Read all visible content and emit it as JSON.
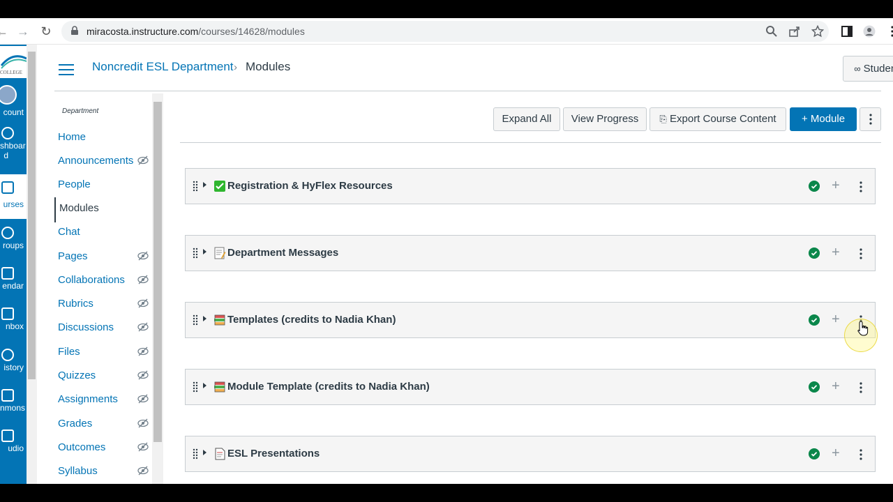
{
  "browser": {
    "url_host": "miracosta.instructure.com",
    "url_path": "/courses/14628/modules"
  },
  "global_nav": {
    "logo": "MiraCosta College",
    "items": [
      {
        "label": "count",
        "icon": "avatar-icon"
      },
      {
        "label": "shboar",
        "label2": "d",
        "icon": "dashboard-icon"
      },
      {
        "label": "urses",
        "icon": "courses-icon",
        "active": true
      },
      {
        "label": "roups",
        "icon": "groups-icon"
      },
      {
        "label": "endar",
        "icon": "calendar-icon"
      },
      {
        "label": "nbox",
        "icon": "inbox-icon"
      },
      {
        "label": "istory",
        "icon": "history-icon"
      },
      {
        "label": "nmons",
        "icon": "commons-icon"
      },
      {
        "label": "udio",
        "icon": "studio-icon"
      }
    ]
  },
  "header": {
    "breadcrumb_course": "Noncredit ESL Department",
    "breadcrumb_sep": "›",
    "breadcrumb_current": "Modules",
    "student_view": "Student View"
  },
  "course_nav": {
    "heading": "Department",
    "items": [
      {
        "label": "Home",
        "hidden": false
      },
      {
        "label": "Announcements",
        "hidden": true
      },
      {
        "label": "People",
        "hidden": false
      },
      {
        "label": "Modules",
        "hidden": false,
        "active": true
      },
      {
        "label": "Chat",
        "hidden": false
      },
      {
        "label": "Pages",
        "hidden": true
      },
      {
        "label": "Collaborations",
        "hidden": true
      },
      {
        "label": "Rubrics",
        "hidden": true
      },
      {
        "label": "Discussions",
        "hidden": true
      },
      {
        "label": "Files",
        "hidden": true
      },
      {
        "label": "Quizzes",
        "hidden": true
      },
      {
        "label": "Assignments",
        "hidden": true
      },
      {
        "label": "Grades",
        "hidden": true
      },
      {
        "label": "Outcomes",
        "hidden": true
      },
      {
        "label": "Syllabus",
        "hidden": true
      }
    ]
  },
  "toolbar": {
    "expand_all": "Expand All",
    "view_progress": "View Progress",
    "export": "Export Course Content",
    "add_module": "+ Module"
  },
  "modules": [
    {
      "title": "Registration & HyFlex Resources",
      "emoji": "check-box-icon",
      "published": true
    },
    {
      "title": "Department Messages",
      "emoji": "memo-icon",
      "published": true
    },
    {
      "title": "Templates (credits to Nadia Khan)",
      "emoji": "books-icon",
      "published": true
    },
    {
      "title": "Module Template (credits to Nadia Khan)",
      "emoji": "books-icon",
      "published": true
    },
    {
      "title": "ESL Presentations",
      "emoji": "page-icon",
      "published": true
    }
  ],
  "colors": {
    "brand": "#0374b5",
    "published": "#0b874b",
    "text": "#2d3b45"
  }
}
